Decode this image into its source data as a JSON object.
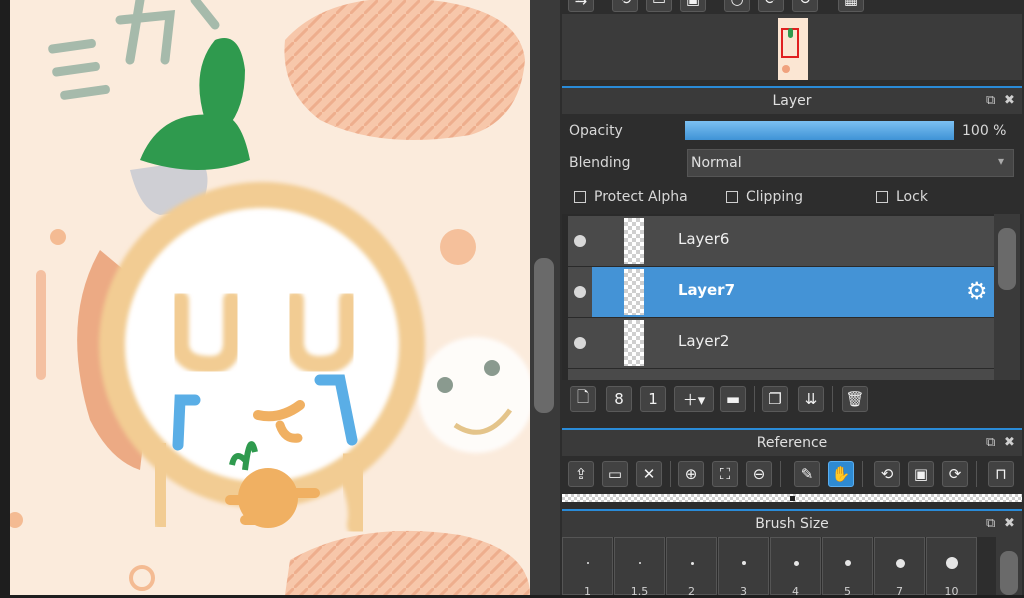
{
  "canvas": {
    "katakana": [
      "ミ",
      "カ"
    ]
  },
  "navigator": {},
  "layer_panel": {
    "title": "Layer",
    "opacity_label": "Opacity",
    "opacity_value": "100 %",
    "opacity_level": 1.0,
    "blending_label": "Blending",
    "blending_value": "Normal",
    "protect_alpha_label": "Protect Alpha",
    "clipping_label": "Clipping",
    "lock_label": "Lock",
    "layers": [
      {
        "name": "Layer6",
        "selected": false
      },
      {
        "name": "Layer7",
        "selected": true
      },
      {
        "name": "Layer2",
        "selected": false
      }
    ],
    "accent_color": "#4493d6"
  },
  "reference_panel": {
    "title": "Reference"
  },
  "brush_size_panel": {
    "title": "Brush Size",
    "sizes": [
      "1",
      "1.5",
      "2",
      "3",
      "4",
      "5",
      "7",
      "10"
    ]
  },
  "icons": {
    "panel_float": "⧉",
    "panel_close": "✖",
    "settings": "⚙",
    "dropdown": "▾"
  }
}
